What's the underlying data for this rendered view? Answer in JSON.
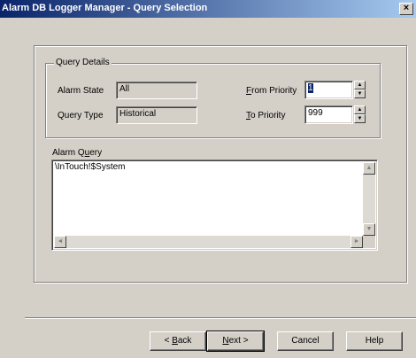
{
  "window": {
    "title": "Alarm DB Logger Manager - Query Selection",
    "close_glyph": "×"
  },
  "query_details": {
    "group_label": "Query Details",
    "alarm_state_label": "Alarm State",
    "alarm_state_value": "All",
    "query_type_label": "Query Type",
    "query_type_value": "Historical",
    "from_priority_label_accel": "F",
    "from_priority_label_rest": "rom Priority",
    "from_priority_value": "1",
    "to_priority_label_accel": "T",
    "to_priority_label_rest": "o Priority",
    "to_priority_value": "999"
  },
  "alarm_query": {
    "label_pre": "Alarm Q",
    "label_accel": "u",
    "label_post": "ery",
    "text": "\\InTouch!$System"
  },
  "buttons": {
    "back_pre": "< ",
    "back_accel": "B",
    "back_post": "ack",
    "next_accel": "N",
    "next_post": "ext >",
    "cancel": "Cancel",
    "help": "Help"
  },
  "icons": {
    "spin_up": "▲",
    "spin_down": "▼",
    "scroll_up": "▲",
    "scroll_down": "▼",
    "scroll_left": "◄",
    "scroll_right": "►"
  }
}
